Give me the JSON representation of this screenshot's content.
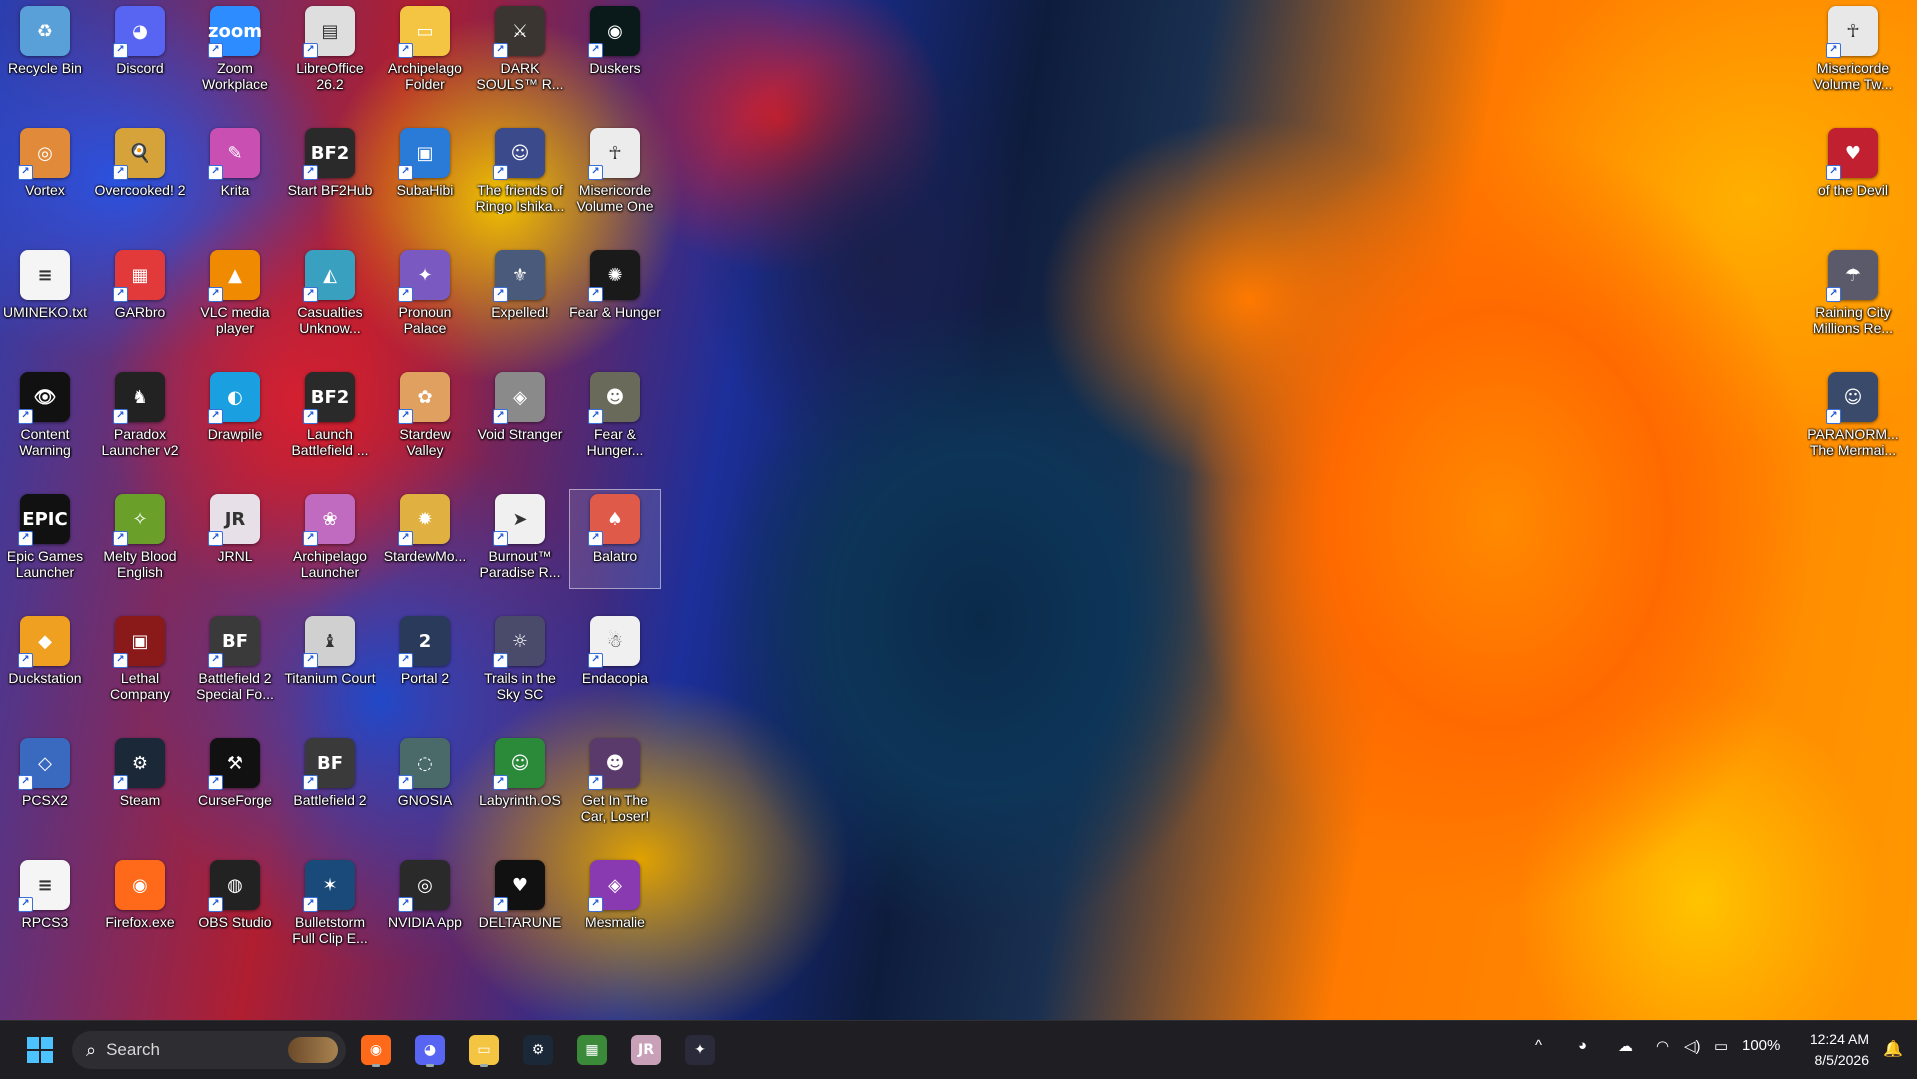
{
  "desktop": {
    "icons": [
      {
        "label": "Recycle Bin",
        "icon": "recycle-bin-icon",
        "color": "#5aa0d8",
        "glyph": "♻",
        "shortcut": false
      },
      {
        "label": "Discord",
        "icon": "discord-icon",
        "color": "#5865f2",
        "glyph": "◕",
        "shortcut": true
      },
      {
        "label": "Zoom Workplace",
        "icon": "zoom-icon",
        "color": "#2d8cff",
        "glyph": "zoom",
        "shortcut": true
      },
      {
        "label": "LibreOffice 26.2",
        "icon": "libreoffice-icon",
        "color": "#dedede",
        "glyph": "▤",
        "shortcut": true
      },
      {
        "label": "Archipelago Folder",
        "icon": "folder-icon",
        "color": "#f4c542",
        "glyph": "▭",
        "shortcut": true
      },
      {
        "label": "DARK SOULS™ R...",
        "icon": "dark-souls-icon",
        "color": "#3a3530",
        "glyph": "⚔",
        "shortcut": true
      },
      {
        "label": "Duskers",
        "icon": "duskers-icon",
        "color": "#0a1a1a",
        "glyph": "◉",
        "shortcut": true
      },
      {
        "label": "Vortex",
        "icon": "vortex-icon",
        "color": "#e08a3a",
        "glyph": "◎",
        "shortcut": true
      },
      {
        "label": "Overcooked! 2",
        "icon": "overcooked-icon",
        "color": "#d6a23a",
        "glyph": "🍳",
        "shortcut": true
      },
      {
        "label": "Krita",
        "icon": "krita-icon",
        "color": "#c94fb3",
        "glyph": "✎",
        "shortcut": true
      },
      {
        "label": "Start BF2Hub",
        "icon": "bf2hub-icon",
        "color": "#2a2a2a",
        "glyph": "BF2",
        "shortcut": true
      },
      {
        "label": "SubaHibi",
        "icon": "subahibi-icon",
        "color": "#2a7ad8",
        "glyph": "▣",
        "shortcut": true
      },
      {
        "label": "The friends of Ringo Ishika...",
        "icon": "ringo-icon",
        "color": "#3a4a8a",
        "glyph": "☺",
        "shortcut": true
      },
      {
        "label": "Misericorde Volume One",
        "icon": "misericorde-icon",
        "color": "#ececec",
        "glyph": "☥",
        "shortcut": true
      },
      {
        "label": "UMINEKO.txt",
        "icon": "text-file-icon",
        "color": "#f5f5f5",
        "glyph": "≡",
        "shortcut": false
      },
      {
        "label": "GARbro",
        "icon": "garbro-icon",
        "color": "#e23a3a",
        "glyph": "▦",
        "shortcut": true
      },
      {
        "label": "VLC media player",
        "icon": "vlc-icon",
        "color": "#f08a00",
        "glyph": "▲",
        "shortcut": true
      },
      {
        "label": "Casualties Unknow...",
        "icon": "casualties-icon",
        "color": "#3aa0c0",
        "glyph": "◭",
        "shortcut": true
      },
      {
        "label": "Pronoun Palace",
        "icon": "pronoun-palace-icon",
        "color": "#7a5ac0",
        "glyph": "✦",
        "shortcut": true
      },
      {
        "label": "Expelled!",
        "icon": "expelled-icon",
        "color": "#4a5a7a",
        "glyph": "⚜",
        "shortcut": true
      },
      {
        "label": "Fear & Hunger",
        "icon": "fear-hunger-icon",
        "color": "#1a1a1a",
        "glyph": "✺",
        "shortcut": true
      },
      {
        "label": "Content Warning",
        "icon": "content-warning-icon",
        "color": "#111",
        "glyph": "👁",
        "shortcut": true
      },
      {
        "label": "Paradox Launcher v2",
        "icon": "paradox-icon",
        "color": "#222",
        "glyph": "♞",
        "shortcut": true
      },
      {
        "label": "Drawpile",
        "icon": "drawpile-icon",
        "color": "#1aa0e0",
        "glyph": "◐",
        "shortcut": true
      },
      {
        "label": "Launch Battlefield ...",
        "icon": "battlefield-launch-icon",
        "color": "#2a2a2a",
        "glyph": "BF2",
        "shortcut": true
      },
      {
        "label": "Stardew Valley",
        "icon": "stardew-icon",
        "color": "#e0a060",
        "glyph": "✿",
        "shortcut": true
      },
      {
        "label": "Void Stranger",
        "icon": "void-stranger-icon",
        "color": "#8a8a8a",
        "glyph": "◈",
        "shortcut": true
      },
      {
        "label": "Fear & Hunger...",
        "icon": "fear-hunger-2-icon",
        "color": "#6a6a5a",
        "glyph": "☻",
        "shortcut": true
      },
      {
        "label": "Epic Games Launcher",
        "icon": "epic-games-icon",
        "color": "#111",
        "glyph": "EPIC",
        "shortcut": true
      },
      {
        "label": "Melty Blood English",
        "icon": "melty-blood-icon",
        "color": "#6aa02a",
        "glyph": "✧",
        "shortcut": true
      },
      {
        "label": "JRNL",
        "icon": "jrnl-icon",
        "color": "#e8e0e8",
        "glyph": "JR",
        "shortcut": true
      },
      {
        "label": "Archipelago Launcher",
        "icon": "archipelago-launcher-icon",
        "color": "#c06ac0",
        "glyph": "❀",
        "shortcut": true
      },
      {
        "label": "StardewMo...",
        "icon": "stardew-mod-icon",
        "color": "#e0b040",
        "glyph": "✹",
        "shortcut": true
      },
      {
        "label": "Burnout™ Paradise R...",
        "icon": "burnout-icon",
        "color": "#f0f0f0",
        "glyph": "➤",
        "shortcut": true
      },
      {
        "label": "Balatro",
        "icon": "balatro-icon",
        "color": "#e05a4a",
        "glyph": "♠",
        "shortcut": true
      },
      {
        "label": "Duckstation",
        "icon": "duckstation-icon",
        "color": "#f0a020",
        "glyph": "◆",
        "shortcut": true
      },
      {
        "label": "Lethal Company",
        "icon": "lethal-company-icon",
        "color": "#8a1a1a",
        "glyph": "▣",
        "shortcut": true
      },
      {
        "label": "Battlefield 2 Special Fo...",
        "icon": "battlefield-sf-icon",
        "color": "#3a3a3a",
        "glyph": "BF",
        "shortcut": true
      },
      {
        "label": "Titanium Court",
        "icon": "titanium-court-icon",
        "color": "#d0d0d0",
        "glyph": "♝",
        "shortcut": true
      },
      {
        "label": "Portal 2",
        "icon": "portal2-icon",
        "color": "#2a3a5a",
        "glyph": "2",
        "shortcut": true
      },
      {
        "label": "Trails in the Sky SC",
        "icon": "trails-icon",
        "color": "#4a4a6a",
        "glyph": "☼",
        "shortcut": true
      },
      {
        "label": "Endacopia",
        "icon": "endacopia-icon",
        "color": "#f0f0f0",
        "glyph": "☃",
        "shortcut": true
      },
      {
        "label": "PCSX2",
        "icon": "pcsx2-icon",
        "color": "#3a6ac0",
        "glyph": "◇",
        "shortcut": true
      },
      {
        "label": "Steam",
        "icon": "steam-icon",
        "color": "#1b2838",
        "glyph": "⚙",
        "shortcut": true
      },
      {
        "label": "CurseForge",
        "icon": "curseforge-icon",
        "color": "#111",
        "glyph": "⚒",
        "shortcut": true
      },
      {
        "label": "Battlefield 2",
        "icon": "battlefield2-icon",
        "color": "#3a3a3a",
        "glyph": "BF",
        "shortcut": true
      },
      {
        "label": "GNOSIA",
        "icon": "gnosia-icon",
        "color": "#4a6a6a",
        "glyph": "◌",
        "shortcut": true
      },
      {
        "label": "Labyrinth.OS",
        "icon": "labyrinth-icon",
        "color": "#2a8a3a",
        "glyph": "☺",
        "shortcut": true
      },
      {
        "label": "Get In The Car, Loser!",
        "icon": "get-in-the-car-icon",
        "color": "#5a3a6a",
        "glyph": "☻",
        "shortcut": true
      },
      {
        "label": "RPCS3",
        "icon": "rpcs3-icon",
        "color": "#f5f5f5",
        "glyph": "≡",
        "shortcut": true
      },
      {
        "label": "Firefox.exe",
        "icon": "firefox-icon",
        "color": "#ff6a1a",
        "glyph": "◉",
        "shortcut": false
      },
      {
        "label": "OBS Studio",
        "icon": "obs-icon",
        "color": "#222",
        "glyph": "◍",
        "shortcut": true
      },
      {
        "label": "Bulletstorm Full Clip E...",
        "icon": "bulletstorm-icon",
        "color": "#1a4a7a",
        "glyph": "✶",
        "shortcut": true
      },
      {
        "label": "NVIDIA App",
        "icon": "nvidia-icon",
        "color": "#2a2a2a",
        "glyph": "◎",
        "shortcut": true
      },
      {
        "label": "DELTARUNE",
        "icon": "deltarune-icon",
        "color": "#111",
        "glyph": "♥",
        "shortcut": true
      },
      {
        "label": "Mesmalie",
        "icon": "mesmalie-icon",
        "color": "#8a3ab0",
        "glyph": "◈",
        "shortcut": true
      }
    ],
    "right_icons": [
      {
        "label": "Misericorde Volume Tw...",
        "icon": "misericorde-2-icon",
        "color": "#e8e8e8",
        "glyph": "☥",
        "shortcut": true
      },
      {
        "label": "of the Devil",
        "icon": "of-the-devil-icon",
        "color": "#c02030",
        "glyph": "♥",
        "shortcut": true
      },
      {
        "label": "Raining City Millions Re...",
        "icon": "raining-city-icon",
        "color": "#5a5a6a",
        "glyph": "☂",
        "shortcut": true
      },
      {
        "label": "PARANORM... The Mermai...",
        "icon": "paranormal-mermaid-icon",
        "color": "#3a4a6a",
        "glyph": "☺",
        "shortcut": true
      }
    ]
  },
  "taskbar": {
    "search_placeholder": "Search",
    "pinned": [
      {
        "name": "firefox-taskbar",
        "icon": "firefox-icon",
        "glyph": "◉",
        "color": "#ff6a1a",
        "running": true
      },
      {
        "name": "discord-taskbar",
        "icon": "discord-icon",
        "glyph": "◕",
        "color": "#5865f2",
        "running": true
      },
      {
        "name": "file-explorer-taskbar",
        "icon": "folder-icon",
        "glyph": "▭",
        "color": "#f4c542",
        "running": true
      },
      {
        "name": "steam-taskbar",
        "icon": "steam-icon",
        "glyph": "⚙",
        "color": "#1b2838",
        "running": false
      },
      {
        "name": "minecraft-taskbar",
        "icon": "minecraft-icon",
        "glyph": "▦",
        "color": "#3a8a3a",
        "running": false
      },
      {
        "name": "jrnl-taskbar",
        "icon": "jrnl-icon",
        "glyph": "JR",
        "color": "#c8a0b8",
        "running": false
      },
      {
        "name": "pronoun-palace-taskbar",
        "icon": "pronoun-palace-icon",
        "glyph": "✦",
        "color": "#2a2a3a",
        "running": false
      }
    ],
    "tray": {
      "chevron": "^",
      "battery": "100%",
      "time": "12:24 AM",
      "date": "8/5/2026"
    }
  }
}
